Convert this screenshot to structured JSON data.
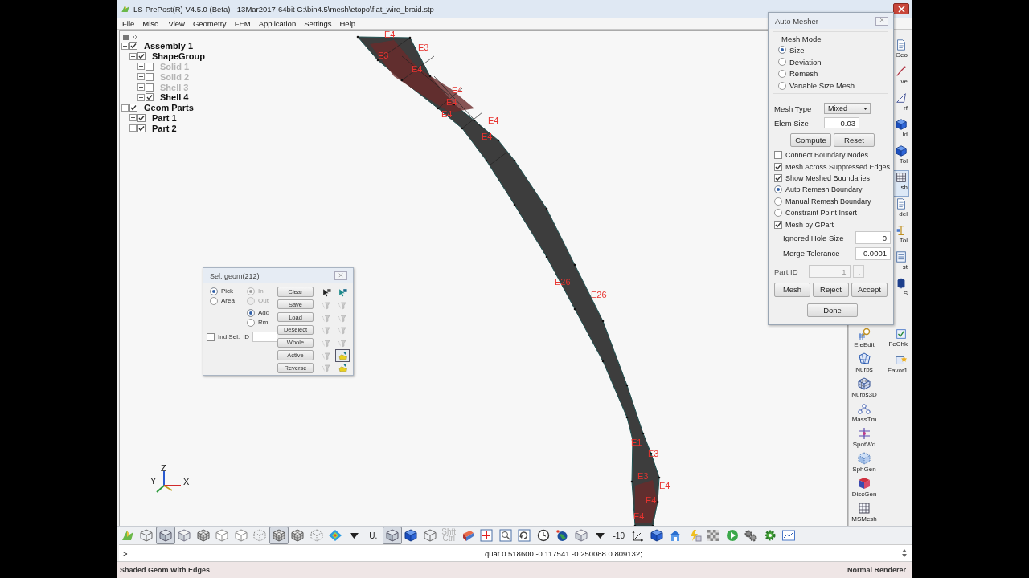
{
  "window": {
    "title": "LS-PrePost(R) V4.5.0 (Beta) - 13Mar2017-64bit G:\\bin4.5\\mesh\\etopo\\flat_wire_braid.stp"
  },
  "menu": [
    "File",
    "Misc.",
    "View",
    "Geometry",
    "FEM",
    "Application",
    "Settings",
    "Help"
  ],
  "tree": [
    {
      "label": "Assembly 1",
      "checked": true,
      "expanded": true,
      "children": [
        {
          "label": "ShapeGroup",
          "checked": true,
          "expanded": true,
          "children": [
            {
              "label": "Solid 1",
              "checked": false,
              "expanded": false
            },
            {
              "label": "Solid 2",
              "checked": false,
              "expanded": false
            },
            {
              "label": "Shell 3",
              "checked": false,
              "expanded": false
            },
            {
              "label": "Shell 4",
              "checked": true,
              "expanded": false
            }
          ]
        }
      ]
    },
    {
      "label": "Geom Parts",
      "checked": true,
      "expanded": true,
      "children": [
        {
          "label": "Part 1",
          "checked": true,
          "expanded": false
        },
        {
          "label": "Part 2",
          "checked": true,
          "expanded": false
        }
      ]
    }
  ],
  "mesh_labels": [
    "E4",
    "E3",
    "E3",
    "E4",
    "E4",
    "E4",
    "E4",
    "E4",
    "E4",
    "E26",
    "E26",
    "E1",
    "E3",
    "E3",
    "E4",
    "E4",
    "E4"
  ],
  "axis_labels": [
    "Z",
    "Y",
    "X"
  ],
  "sel_geom": {
    "title": "Sel. geom(212)",
    "pick_mode": [
      {
        "label": "Pick",
        "selected": true
      },
      {
        "label": "Area",
        "selected": false
      }
    ],
    "inside": [
      {
        "label": "In",
        "selected": true,
        "disabled": true
      },
      {
        "label": "Out",
        "selected": false,
        "disabled": true
      }
    ],
    "add_mode": [
      {
        "label": "Add",
        "selected": true
      },
      {
        "label": "Rm",
        "selected": false
      }
    ],
    "ind_sel": {
      "label": "Ind Sel.",
      "checked": false
    },
    "id_field": {
      "label": "ID"
    },
    "buttons": [
      "Clear",
      "Save",
      "Load",
      "Deselect",
      "Whole",
      "Active",
      "Reverse"
    ],
    "tools": [
      {
        "selected": false
      },
      {
        "selected": false
      },
      {
        "selected": false
      },
      {
        "selected": false
      },
      {
        "selected": false
      },
      {
        "selected": false
      },
      {
        "selected": false
      },
      {
        "selected": false
      },
      {
        "selected": false
      },
      {
        "selected": false
      },
      {
        "selected": false
      },
      {
        "selected": true
      },
      {
        "selected": false
      },
      {
        "selected": false
      }
    ]
  },
  "auto_mesher": {
    "title": "Auto Mesher",
    "mesh_mode": {
      "label": "Mesh Mode",
      "options": [
        {
          "label": "Size",
          "selected": true
        },
        {
          "label": "Deviation",
          "selected": false
        },
        {
          "label": "Remesh",
          "selected": false
        },
        {
          "label": "Variable Size Mesh",
          "selected": false
        }
      ]
    },
    "mesh_type": {
      "label": "Mesh Type",
      "value": "Mixed"
    },
    "elem_size": {
      "label": "Elem Size",
      "value": "0.03"
    },
    "action_buttons": [
      "Compute",
      "Reset"
    ],
    "options": [
      {
        "kind": "checkbox",
        "label": "Connect Boundary Nodes",
        "checked": false
      },
      {
        "kind": "checkbox",
        "label": "Mesh Across Suppressed Edges",
        "checked": true
      },
      {
        "kind": "checkbox",
        "label": "Show Meshed Boundaries",
        "checked": true
      },
      {
        "kind": "radio",
        "label": "Auto Remesh Boundary",
        "selected": true
      },
      {
        "kind": "radio",
        "label": "Manual Remesh Boundary",
        "selected": false
      },
      {
        "kind": "radio",
        "label": "Constraint Point Insert",
        "selected": false
      },
      {
        "kind": "checkbox",
        "label": "Mesh by GPart",
        "checked": true
      }
    ],
    "fields": [
      {
        "label": "Ignored Hole Size",
        "value": "0"
      },
      {
        "label": "Merge Tolerance",
        "value": "0.0001"
      }
    ],
    "part_id": {
      "label": "Part ID",
      "value": "1",
      "disabled": true,
      "button": "."
    },
    "buttons": [
      "Mesh",
      "Reject",
      "Accept"
    ],
    "done": "Done"
  },
  "right_toolbar": {
    "column_1": [
      {
        "label": "EleEdit",
        "selected": false
      },
      {
        "label": "Nurbs",
        "selected": false
      },
      {
        "label": "Nurbs3D",
        "selected": false
      },
      {
        "label": "MassTm",
        "selected": false
      },
      {
        "label": "SpotWd",
        "selected": false
      },
      {
        "label": "SphGen",
        "selected": false
      },
      {
        "label": "DiscGen",
        "selected": false
      },
      {
        "label": "MSMesh",
        "selected": false
      }
    ],
    "column_2": [
      {
        "label": "Geo",
        "selected": false
      },
      {
        "label": "ve",
        "selected": false
      },
      {
        "label": "rf",
        "selected": false
      },
      {
        "label": "ld",
        "selected": false
      },
      {
        "label": "Tol",
        "selected": false
      },
      {
        "label": "sh",
        "selected": true
      },
      {
        "label": "del",
        "selected": false
      },
      {
        "label": "Tol",
        "selected": false
      },
      {
        "label": "st",
        "selected": false
      },
      {
        "label": "S",
        "selected": false
      },
      {
        "label": "FeChk",
        "selected": false
      },
      {
        "label": "Favor1",
        "selected": false
      }
    ]
  },
  "bottom_toolbar": [
    {
      "kind": "tool",
      "selected": false
    },
    {
      "kind": "tool",
      "selected": false
    },
    {
      "kind": "tool",
      "selected": true
    },
    {
      "kind": "tool",
      "selected": false
    },
    {
      "kind": "tool",
      "selected": false
    },
    {
      "kind": "tool",
      "selected": false
    },
    {
      "kind": "tool",
      "selected": false
    },
    {
      "kind": "tool",
      "selected": false
    },
    {
      "kind": "tool",
      "selected": true
    },
    {
      "kind": "tool",
      "selected": false
    },
    {
      "kind": "tool",
      "selected": false
    },
    {
      "kind": "tool",
      "selected": false
    },
    {
      "kind": "tool",
      "selected": false
    },
    {
      "kind": "text",
      "label": "U.",
      "disabled": false
    },
    {
      "kind": "tool",
      "selected": true
    },
    {
      "kind": "tool",
      "selected": false
    },
    {
      "kind": "tool",
      "selected": false
    },
    {
      "kind": "text",
      "label": "Shft Ctrl",
      "disabled": true
    },
    {
      "kind": "tool",
      "selected": false
    },
    {
      "kind": "tool",
      "selected": false
    },
    {
      "kind": "tool",
      "selected": false
    },
    {
      "kind": "tool",
      "selected": false
    },
    {
      "kind": "tool",
      "selected": false
    },
    {
      "kind": "tool",
      "selected": false
    },
    {
      "kind": "tool",
      "selected": false
    },
    {
      "kind": "tool",
      "selected": false
    },
    {
      "kind": "text",
      "label": "-10",
      "disabled": false
    },
    {
      "kind": "tool",
      "selected": false
    },
    {
      "kind": "tool",
      "selected": false
    },
    {
      "kind": "tool",
      "selected": false
    },
    {
      "kind": "tool",
      "selected": false
    },
    {
      "kind": "tool",
      "selected": false
    },
    {
      "kind": "tool",
      "selected": false
    },
    {
      "kind": "tool",
      "selected": false
    },
    {
      "kind": "tool",
      "selected": false
    },
    {
      "kind": "tool",
      "selected": false
    }
  ],
  "command_line": {
    "prompt": ">",
    "output": "quat 0.518600 -0.117541 -0.250088 0.809132;"
  },
  "status_bar": {
    "left": "Shaded Geom With Edges",
    "right": "Normal Renderer"
  }
}
